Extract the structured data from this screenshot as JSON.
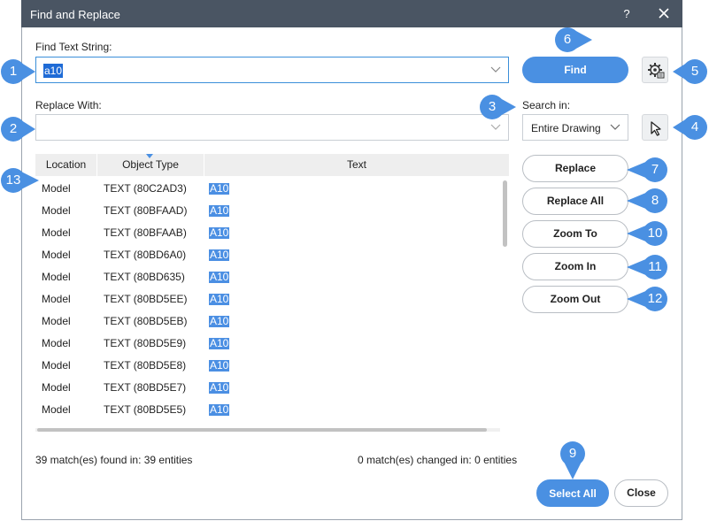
{
  "window": {
    "title": "Find and Replace",
    "help_label": "?"
  },
  "find": {
    "label": "Find Text String:",
    "value": "a10"
  },
  "replace": {
    "label": "Replace With:",
    "value": ""
  },
  "search_in": {
    "label": "Search in:",
    "value": "Entire Drawing"
  },
  "buttons": {
    "find": "Find",
    "replace": "Replace",
    "replace_all": "Replace All",
    "zoom_to": "Zoom To",
    "zoom_in": "Zoom In",
    "zoom_out": "Zoom Out",
    "select_all": "Select All",
    "close": "Close"
  },
  "table": {
    "columns": [
      "Location",
      "Object Type",
      "Text"
    ],
    "rows": [
      [
        "Model",
        "TEXT (80C2AD3)",
        "A10"
      ],
      [
        "Model",
        "TEXT (80BFAAD)",
        "A10"
      ],
      [
        "Model",
        "TEXT (80BFAAB)",
        "A10"
      ],
      [
        "Model",
        "TEXT (80BD6A0)",
        "A10"
      ],
      [
        "Model",
        "TEXT (80BD635)",
        "A10"
      ],
      [
        "Model",
        "TEXT (80BD5EE)",
        "A10"
      ],
      [
        "Model",
        "TEXT (80BD5EB)",
        "A10"
      ],
      [
        "Model",
        "TEXT (80BD5E9)",
        "A10"
      ],
      [
        "Model",
        "TEXT (80BD5E8)",
        "A10"
      ],
      [
        "Model",
        "TEXT (80BD5E7)",
        "A10"
      ],
      [
        "Model",
        "TEXT (80BD5E5)",
        "A10"
      ]
    ]
  },
  "status": {
    "found": "39 match(es) found in: 39 entities",
    "changed": "0 match(es) changed in: 0 entities"
  },
  "callouts": [
    "1",
    "2",
    "3",
    "4",
    "5",
    "6",
    "7",
    "8",
    "9",
    "10",
    "11",
    "12",
    "13"
  ],
  "colors": {
    "accent": "#4a90e2",
    "titlebar": "#4a5563",
    "highlight": "#4b8fe3",
    "callout": "#4a90e2"
  },
  "icons": [
    "close-icon",
    "chevron-down-icon",
    "settings-gear-icon",
    "select-pointer-icon",
    "sort-indicator-icon"
  ]
}
